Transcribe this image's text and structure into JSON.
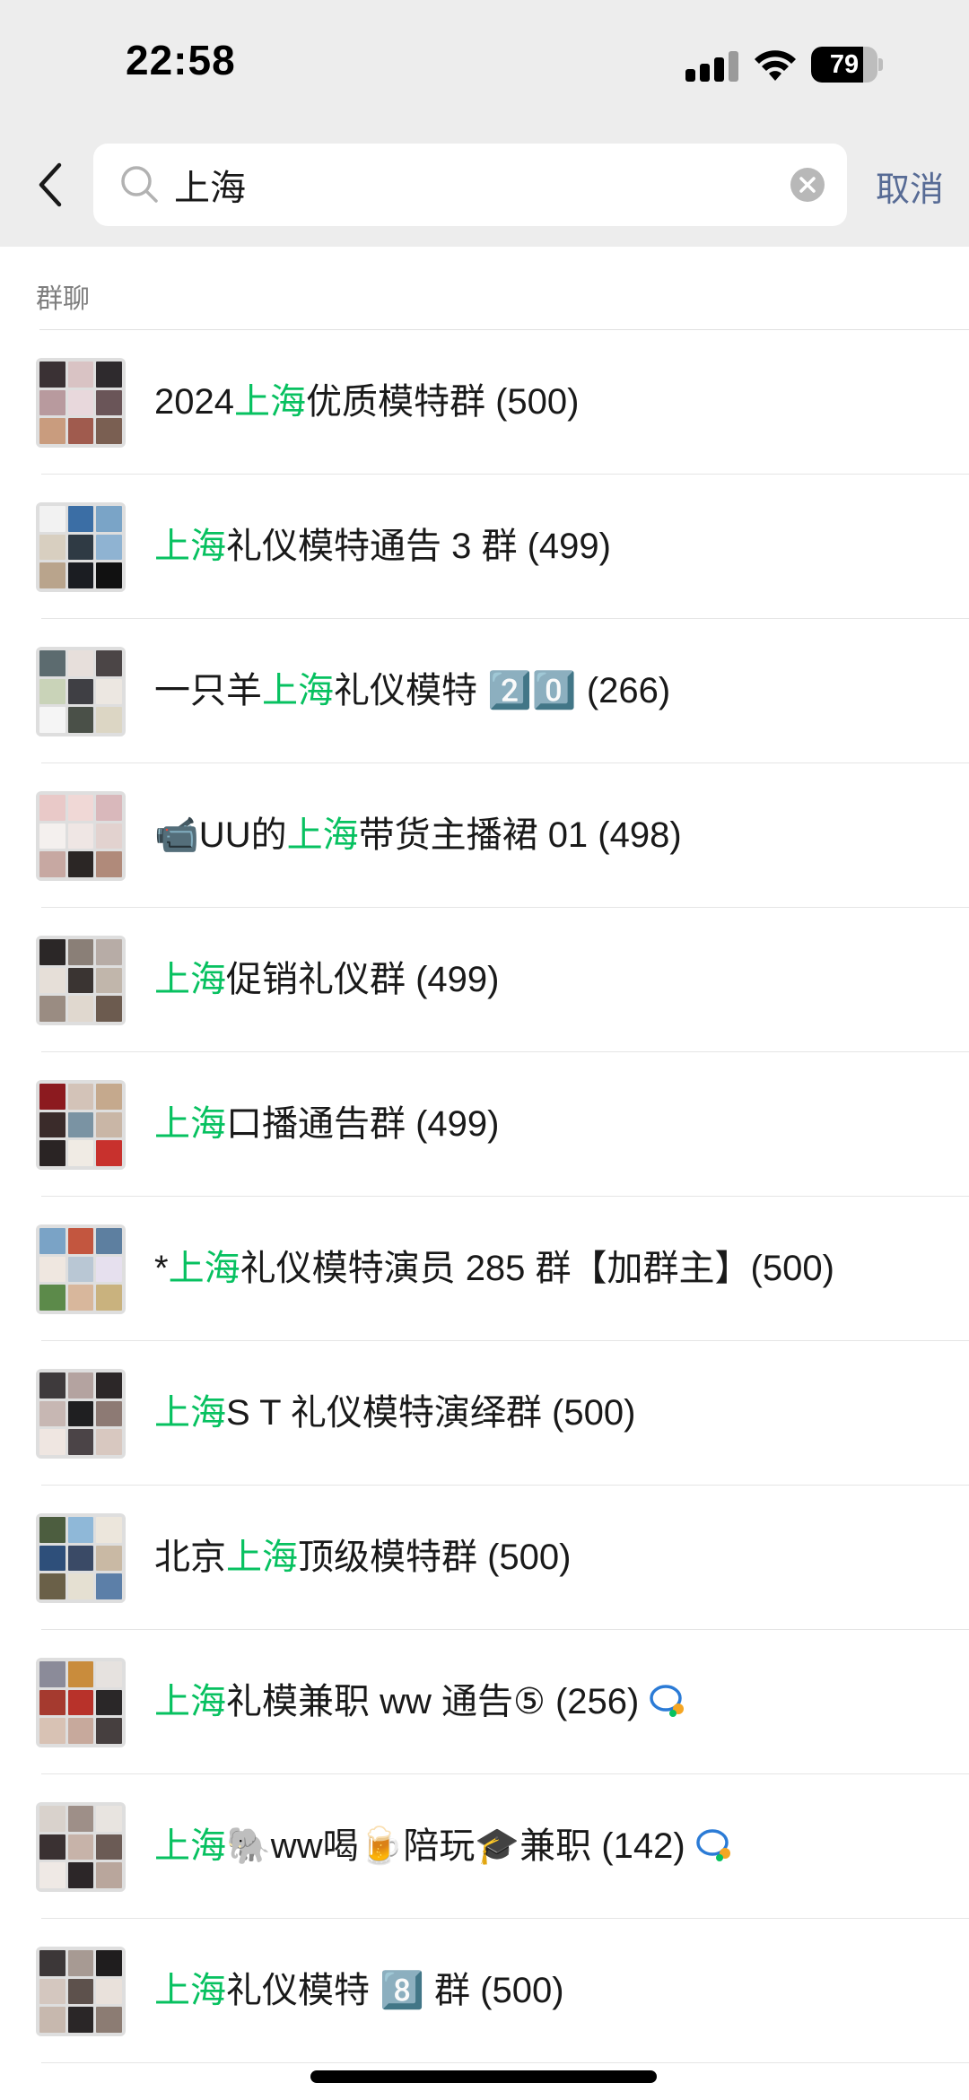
{
  "status_bar": {
    "time": "22:58",
    "battery_level": 79,
    "battery_label": "79"
  },
  "search": {
    "query": "上海",
    "cancel_label": "取消"
  },
  "section": {
    "title": "群聊"
  },
  "highlight_color": "#07c160",
  "groups": [
    {
      "prefix": "2024",
      "match": "上海",
      "suffix": "优质模特群 (500)",
      "tiles": [
        "#3a3134",
        "#d9c3c4",
        "#2e2a2d",
        "#b89a9e",
        "#e8d8dc",
        "#6a5558",
        "#c99c7e",
        "#a05b4e",
        "#7a5f52"
      ]
    },
    {
      "prefix": "",
      "match": "上海",
      "suffix": "礼仪模特通告 3 群 (499)",
      "tiles": [
        "#f2f2f2",
        "#3b6ea5",
        "#7aa4c7",
        "#d8cfc0",
        "#2f3a44",
        "#8fb3d2",
        "#b9a48c",
        "#1b1d22",
        "#111111"
      ]
    },
    {
      "prefix": "一只羊",
      "match": "上海",
      "suffix": "礼仪模特 2️⃣0️⃣ (266)",
      "tiles": [
        "#5c6b6f",
        "#e7dfdb",
        "#4b4546",
        "#c9d3b8",
        "#3f3f44",
        "#ece7e1",
        "#f5f5f5",
        "#4a5048",
        "#dcd6c4"
      ]
    },
    {
      "prefix": "📹UU的",
      "match": "上海",
      "suffix": "带货主播裙 01 (498)",
      "tiles": [
        "#e9c9c8",
        "#f0d8d6",
        "#d9b8bb",
        "#f4f0ee",
        "#efe6e4",
        "#e2d2cf",
        "#c7a8a2",
        "#2b2625",
        "#b08a7a"
      ]
    },
    {
      "prefix": "",
      "match": "上海",
      "suffix": "促销礼仪群 (499)",
      "tiles": [
        "#2b2727",
        "#8a7f77",
        "#b7aca6",
        "#e6dfd8",
        "#3a3432",
        "#c1b6ab",
        "#9a8c82",
        "#e0d8cf",
        "#6c5b4f"
      ]
    },
    {
      "prefix": "",
      "match": "上海",
      "suffix": "口播通告群 (499)",
      "tiles": [
        "#8c1a1f",
        "#d3c3b8",
        "#c5a98d",
        "#3a2b2a",
        "#7a93a3",
        "#c9b6a6",
        "#2a2424",
        "#f0ebe4",
        "#c8312d"
      ]
    },
    {
      "prefix": "*",
      "match": "上海",
      "suffix": "礼仪模特演员 285 群【加群主】(500)",
      "tiles": [
        "#7aa3c6",
        "#c3563f",
        "#5d7fa0",
        "#efe7e0",
        "#b9c7d4",
        "#e6e0ee",
        "#5c8a4a",
        "#d8b79c",
        "#c9b27e"
      ]
    },
    {
      "prefix": "",
      "match": "上海",
      "suffix": "S T 礼仪模特演绎群 (500)",
      "tiles": [
        "#3e3a3c",
        "#b4a3a0",
        "#2c2728",
        "#c7b7b3",
        "#1f1f21",
        "#8d7a74",
        "#efe6e1",
        "#4b4447",
        "#d8c8c0"
      ]
    },
    {
      "prefix": "北京",
      "match": "上海",
      "suffix": "顶级模特群 (500)",
      "tiles": [
        "#4c5d3f",
        "#8fb8d8",
        "#ece6dc",
        "#2e4f7a",
        "#3a4a66",
        "#c9b9a4",
        "#6a6048",
        "#e5e0d2",
        "#5c7fa8"
      ]
    },
    {
      "prefix": "",
      "match": "上海",
      "suffix": "礼模兼职 ww 通告⑤ (256)",
      "badge": true,
      "tiles": [
        "#8b8b99",
        "#c98c3c",
        "#e6e2df",
        "#a53a2f",
        "#b8322a",
        "#2a2728",
        "#d8c2b4",
        "#c7a99c",
        "#463f3f"
      ]
    },
    {
      "prefix": "",
      "match": "上海",
      "suffix": "🐘ww喝🍺陪玩🎓兼职 (142)",
      "badge": true,
      "tiles": [
        "#d9d2cc",
        "#9e8f88",
        "#e8e4e0",
        "#3a3132",
        "#c7b3a9",
        "#6b5b55",
        "#efe9e5",
        "#2c2628",
        "#b9a69c"
      ]
    },
    {
      "prefix": "",
      "match": "上海",
      "suffix": "礼仪模特 8️⃣ 群 (500)",
      "tiles": [
        "#3c3738",
        "#a79a93",
        "#1f1d1e",
        "#d4c7bf",
        "#5d514c",
        "#e9e1db",
        "#c7b8ae",
        "#2a2627",
        "#8c7c73"
      ]
    }
  ]
}
